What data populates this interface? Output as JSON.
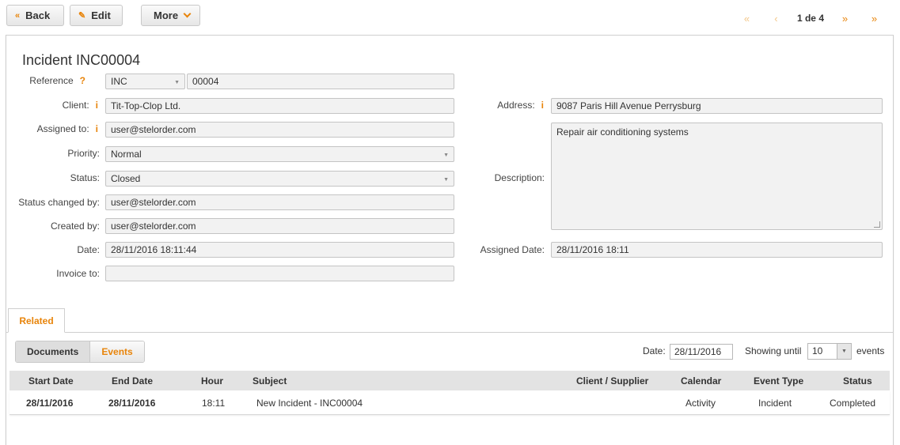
{
  "toolbar": {
    "back_label": "Back",
    "edit_label": "Edit",
    "more_label": "More"
  },
  "pager": {
    "text": "1 de 4"
  },
  "incident": {
    "title": "Incident INC00004",
    "reference_label": "Reference",
    "reference_prefix": "INC",
    "reference_number": "00004",
    "client_label": "Client:",
    "client": "Tit-Top-Clop Ltd.",
    "assigned_to_label": "Assigned to:",
    "assigned_to": "user@stelorder.com",
    "priority_label": "Priority:",
    "priority": "Normal",
    "status_label": "Status:",
    "status": "Closed",
    "status_changed_by_label": "Status changed by:",
    "status_changed_by": "user@stelorder.com",
    "created_by_label": "Created by:",
    "created_by": "user@stelorder.com",
    "date_label": "Date:",
    "date": "28/11/2016 18:11:44",
    "invoice_to_label": "Invoice to:",
    "invoice_to": "",
    "address_label": "Address:",
    "address": "9087 Paris Hill Avenue  Perrysburg",
    "description_label": "Description:",
    "description": "Repair air conditioning systems",
    "assigned_date_label": "Assigned Date:",
    "assigned_date": "28/11/2016 18:11",
    "hint_question": "?",
    "hint_info": "i"
  },
  "tabs": {
    "related": "Related"
  },
  "related": {
    "documents_label": "Documents",
    "events_label": "Events",
    "date_label": "Date:",
    "date_value": "28/11/2016",
    "showing_until_label": "Showing until",
    "showing_count": "10",
    "events_suffix": "events",
    "columns": [
      "Start Date",
      "End Date",
      "Hour",
      "Subject",
      "Client / Supplier",
      "Calendar",
      "Event Type",
      "Status"
    ],
    "rows": [
      {
        "start_date": "28/11/2016",
        "end_date": "28/11/2016",
        "hour": "18:11",
        "subject": "New Incident - INC00004",
        "client_supplier": "",
        "calendar": "Activity",
        "event_type": "Incident",
        "status": "Completed"
      }
    ]
  },
  "colors": {
    "accent": "#e8840a"
  }
}
